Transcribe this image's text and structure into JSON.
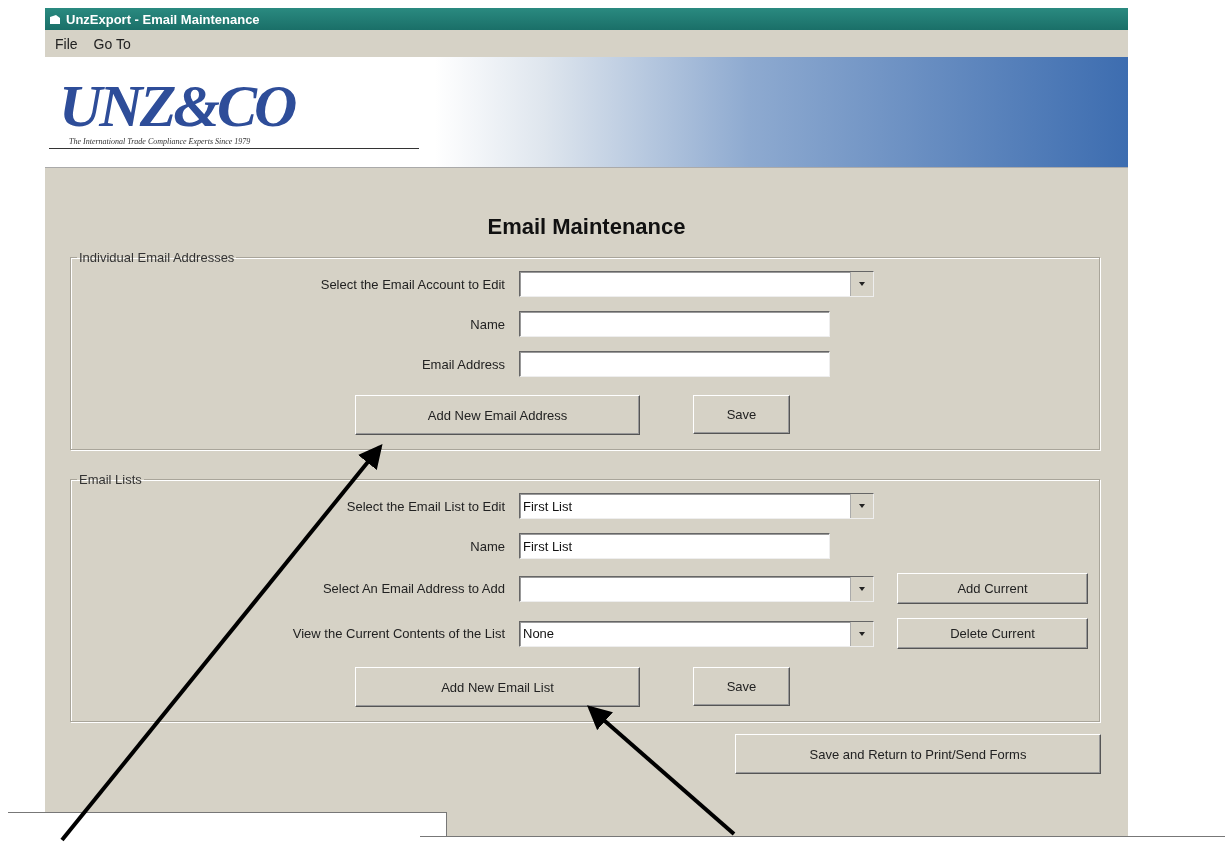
{
  "window": {
    "title": "UnzExport - Email Maintenance"
  },
  "menu": [
    {
      "label": "File"
    },
    {
      "label": "Go To"
    }
  ],
  "banner": {
    "logo": "UNZ&CO",
    "tagline": "The International Trade Compliance Experts Since 1979"
  },
  "heading": "Email Maintenance",
  "sections": [
    {
      "title": "Individual Email Addresses",
      "fields": [
        {
          "kind": "combo",
          "label": "Select the Email Account to Edit"
        },
        {
          "kind": "text",
          "label": "Name"
        },
        {
          "kind": "text",
          "label": "Email Address"
        }
      ],
      "buttons": [
        "Add New Email Address",
        "Save"
      ]
    },
    {
      "title": "Email Lists",
      "fields": [
        {
          "kind": "combo",
          "label": "Select the Email List to Edit",
          "value": "First List"
        },
        {
          "kind": "text",
          "label": "Name",
          "value": "First List"
        },
        {
          "kind": "combo",
          "label": "Select An Email Address to Add",
          "action": "Add Current"
        },
        {
          "kind": "combo",
          "label": "View the Current Contents of the List",
          "value": "None",
          "action": "Delete Current"
        }
      ],
      "buttons": [
        "Add New Email List",
        "Save"
      ]
    }
  ],
  "footer_button": "Save and Return to Print/Send Forms"
}
